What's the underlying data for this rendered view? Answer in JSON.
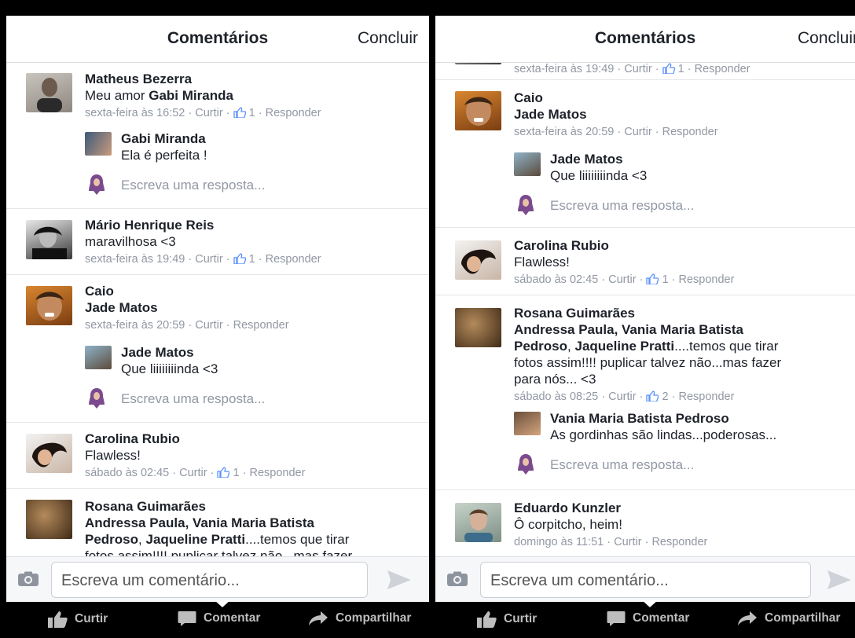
{
  "header": {
    "title": "Comentários",
    "done": "Concluir"
  },
  "composer": {
    "placeholder": "Escreva um comentário..."
  },
  "tabs": {
    "like": "Curtir",
    "comment": "Comentar",
    "share": "Compartilhar"
  },
  "actions": {
    "like": "Curtir",
    "reply": "Responder",
    "write_reply": "Escreva uma resposta..."
  },
  "left": {
    "c1": {
      "name": "Matheus Bezerra",
      "text_prefix": "Meu amor ",
      "text_tag": "Gabi Miranda",
      "time": "sexta-feira às 16:52",
      "likes": "1"
    },
    "c1r": {
      "name": "Gabi Miranda",
      "text": "Ela é perfeita !"
    },
    "c2": {
      "name": "Mário Henrique Reis",
      "text": "maravilhosa <3",
      "time": "sexta-feira às 19:49",
      "likes": "1"
    },
    "c3": {
      "name": "Caio",
      "tag": "Jade Matos",
      "time": "sexta-feira às 20:59"
    },
    "c3r": {
      "name": "Jade Matos",
      "text": "Que liiiiiiiinda <3"
    },
    "c4": {
      "name": "Carolina Rubio",
      "text": "Flawless!",
      "time": "sábado às 02:45",
      "likes": "1"
    },
    "c5": {
      "name": "Rosana Guimarães",
      "tag1": "Andressa Paula",
      "sep1": ", ",
      "tag2": "Vania Maria Batista",
      "tag3": "Pedroso",
      "sep2": ", ",
      "tag4": "Jaqueline Pratti",
      "text1": "....temos que tirar",
      "text2": "fotos assim!!!! puplicar talvez não...mas fazer"
    }
  },
  "right": {
    "c0": {
      "time": "sexta-feira às 19:49",
      "likes": "1"
    },
    "c1": {
      "name": "Caio",
      "tag": "Jade Matos",
      "time": "sexta-feira às 20:59"
    },
    "c1r": {
      "name": "Jade Matos",
      "text": "Que liiiiiiiinda <3"
    },
    "c2": {
      "name": "Carolina Rubio",
      "text": "Flawless!",
      "time": "sábado às 02:45",
      "likes": "1"
    },
    "c3": {
      "name": "Rosana Guimarães",
      "tag1": "Andressa Paula",
      "sep1": ", ",
      "tag2": "Vania Maria Batista",
      "tag3": "Pedroso",
      "sep2": ", ",
      "tag4": "Jaqueline Pratti",
      "text1": "....temos que tirar",
      "text2": "fotos assim!!!! puplicar talvez não...mas fazer",
      "text3": "para nós... <3",
      "time": "sábado às 08:25",
      "likes": "2"
    },
    "c3r": {
      "name": "Vania Maria Batista Pedroso",
      "text": "As gordinhas são lindas...poderosas..."
    },
    "c4": {
      "name": "Eduardo Kunzler",
      "text": "Ô corpitcho, heim!",
      "time": "domingo às 11:51"
    }
  }
}
